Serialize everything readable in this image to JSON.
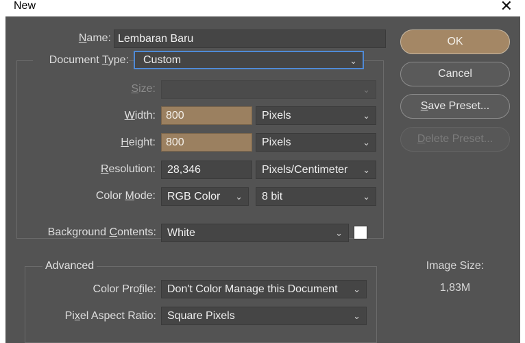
{
  "window": {
    "title": "New",
    "close_glyph": "✕"
  },
  "name": {
    "label_u": "N",
    "label_rest": "ame:",
    "value": "Lembaran Baru"
  },
  "document_type": {
    "label_pre": "Document ",
    "label_u": "T",
    "label_rest": "ype:",
    "value": "Custom"
  },
  "size": {
    "label_u": "S",
    "label_rest": "ize:",
    "value": ""
  },
  "width": {
    "label_u": "W",
    "label_rest": "idth:",
    "value": "800",
    "unit": "Pixels"
  },
  "height": {
    "label_u": "H",
    "label_rest": "eight:",
    "value": "800",
    "unit": "Pixels"
  },
  "resolution": {
    "label_u": "R",
    "label_rest": "esolution:",
    "value": "28,346",
    "unit": "Pixels/Centimeter"
  },
  "color_mode": {
    "label_pre": "Color ",
    "label_u": "M",
    "label_rest": "ode:",
    "value": "RGB Color",
    "depth": "8 bit"
  },
  "background": {
    "label_pre": "Background ",
    "label_u": "C",
    "label_rest": "ontents:",
    "value": "White",
    "swatch_color": "#ffffff"
  },
  "advanced": {
    "title": "Advanced",
    "color_profile": {
      "label_pre": "Color Pro",
      "label_u": "f",
      "label_rest": "ile:",
      "value": "Don't Color Manage this Document"
    },
    "pixel_aspect": {
      "label_pre": "Pi",
      "label_u": "x",
      "label_rest": "el Aspect Ratio:",
      "value": "Square Pixels"
    }
  },
  "buttons": {
    "ok": "OK",
    "cancel": "Cancel",
    "save_preset_u": "S",
    "save_preset_rest": "ave Preset...",
    "delete_preset_u": "D",
    "delete_preset_rest": "elete Preset..."
  },
  "image_size": {
    "label": "Image Size:",
    "value": "1,83M"
  },
  "icons": {
    "dropdown": "chevron-down-icon",
    "close": "close-icon"
  }
}
